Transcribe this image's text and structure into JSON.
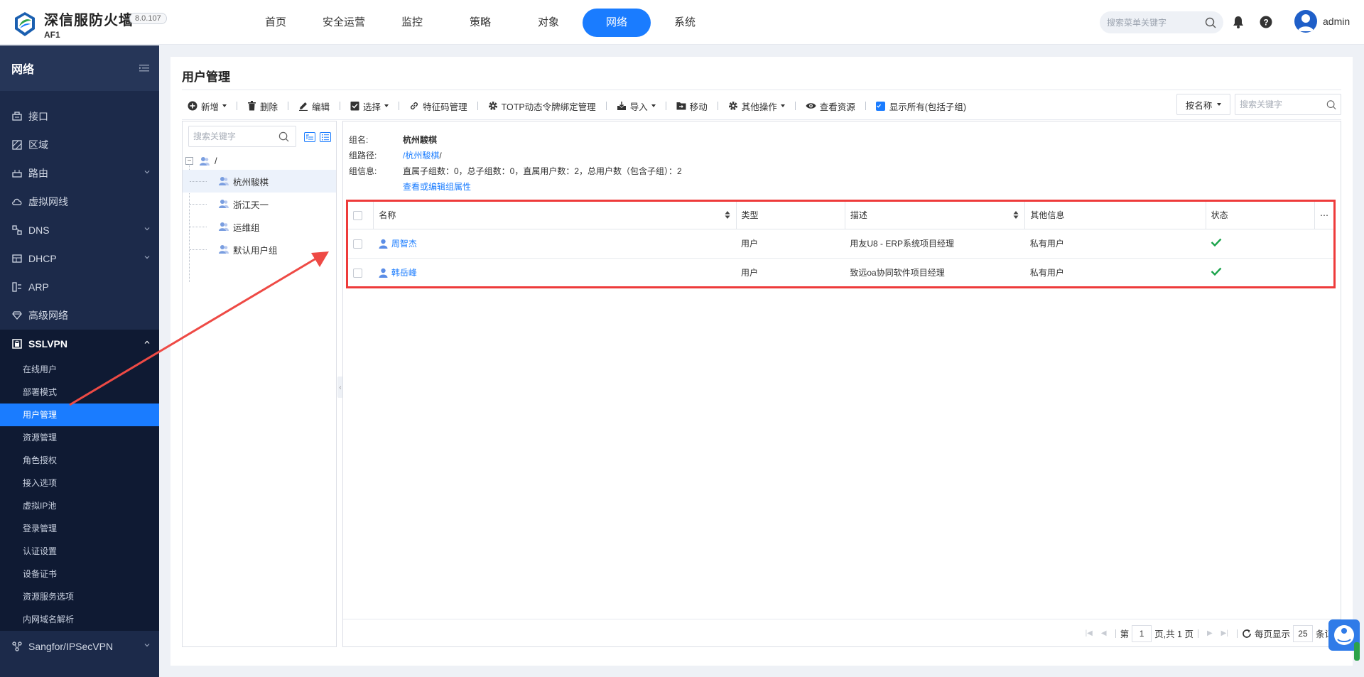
{
  "app": {
    "title": "深信服防火墙",
    "product": "AF1",
    "version": "8.0.107"
  },
  "topnav": {
    "items": [
      {
        "label": "首页"
      },
      {
        "label": "安全运营"
      },
      {
        "label": "监控"
      },
      {
        "label": "策略"
      },
      {
        "label": "对象"
      },
      {
        "label": "网络",
        "active": true
      },
      {
        "label": "系统"
      }
    ],
    "search_placeholder": "搜索菜单关键字",
    "username": "admin"
  },
  "sidebar": {
    "title": "网络",
    "items": [
      {
        "label": "接口",
        "icon": "interface-icon"
      },
      {
        "label": "区域",
        "icon": "zone-icon"
      },
      {
        "label": "路由",
        "icon": "route-icon"
      },
      {
        "label": "虚拟网线",
        "icon": "cloud-icon"
      },
      {
        "label": "DNS",
        "icon": "dns-icon"
      },
      {
        "label": "DHCP",
        "icon": "dhcp-icon"
      },
      {
        "label": "ARP",
        "icon": "arp-icon"
      },
      {
        "label": "高级网络",
        "icon": "diamond-icon"
      },
      {
        "label": "SSLVPN",
        "icon": "lock-icon"
      }
    ],
    "sslvpn_sub": [
      {
        "label": "在线用户"
      },
      {
        "label": "部署模式"
      },
      {
        "label": "用户管理",
        "active": true
      },
      {
        "label": "资源管理"
      },
      {
        "label": "角色授权"
      },
      {
        "label": "接入选项"
      },
      {
        "label": "虚拟IP池"
      },
      {
        "label": "登录管理"
      },
      {
        "label": "认证设置"
      },
      {
        "label": "设备证书"
      },
      {
        "label": "资源服务选项"
      },
      {
        "label": "内网域名解析"
      }
    ],
    "last_item": {
      "label": "Sangfor/IPSecVPN",
      "icon": "network-icon"
    }
  },
  "page": {
    "title": "用户管理"
  },
  "toolbar": {
    "add": "新增",
    "delete": "删除",
    "edit": "编辑",
    "select": "选择",
    "feature_code": "特征码管理",
    "totp": "TOTP动态令牌绑定管理",
    "import": "导入",
    "move": "移动",
    "other": "其他操作",
    "view_resources": "查看资源",
    "show_all": "显示所有(包括子组)",
    "sort_by": "按名称",
    "search_placeholder": "搜索关键字"
  },
  "tree": {
    "search_placeholder": "搜索关键字",
    "root": "/",
    "nodes": [
      {
        "label": "杭州駿棋",
        "selected": true
      },
      {
        "label": "浙江天一"
      },
      {
        "label": "运维组"
      },
      {
        "label": "默认用户组"
      }
    ]
  },
  "group_info": {
    "name_label": "组名:",
    "name": "杭州駿棋",
    "path_label": "组路径:",
    "path_link": "/杭州駿棋",
    "path_suffix": "/",
    "info_label": "组信息:",
    "info": "直属子组数：0，总子组数：0，直属用户数：2，总用户数（包含子组）：2",
    "edit_link": "查看或编辑组属性"
  },
  "table": {
    "columns": [
      "名称",
      "类型",
      "描述",
      "其他信息",
      "状态"
    ],
    "rows": [
      {
        "name": "周智杰",
        "type": "用户",
        "desc": "用友U8 - ERP系统项目经理",
        "other": "私有用户",
        "status": "enabled"
      },
      {
        "name": "韩岳峰",
        "type": "用户",
        "desc": "致远oa协同软件项目经理",
        "other": "私有用户",
        "status": "enabled"
      }
    ]
  },
  "pager": {
    "page_prefix": "第",
    "page": "1",
    "page_suffix": "页,共 1 页",
    "per_page_label": "每页显示",
    "per_page": "25",
    "per_page_suffix": "条记"
  },
  "colors": {
    "accent": "#1a7cff",
    "sidebar_bg": "#1c2a4a",
    "annotation": "#ee3b3b",
    "status_ok": "#1aa34a"
  }
}
